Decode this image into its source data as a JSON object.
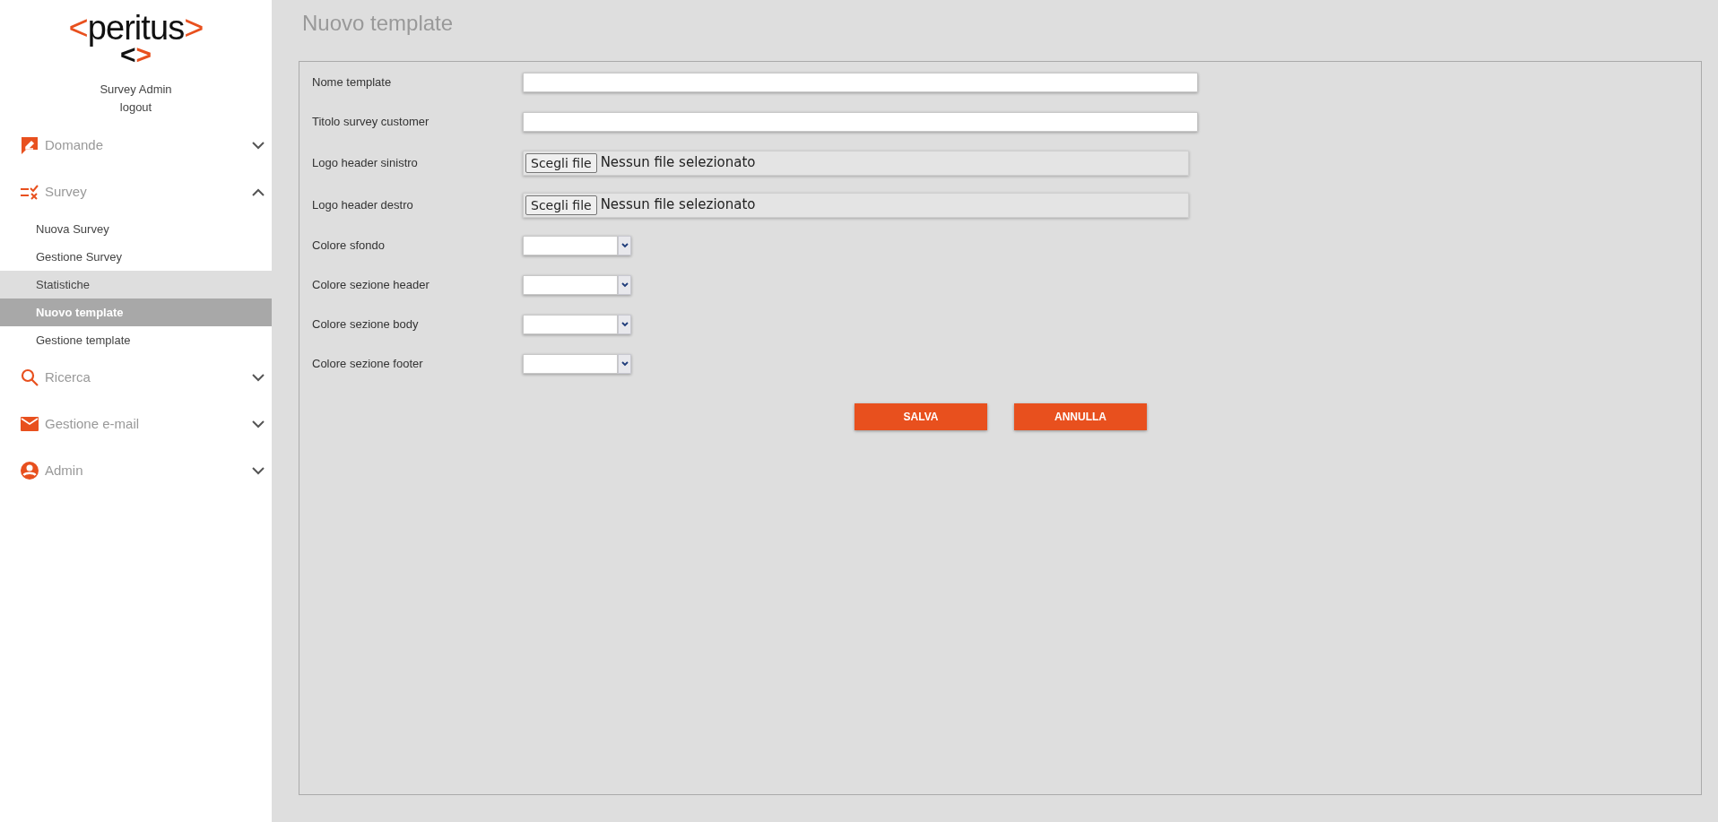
{
  "sidebar": {
    "logo": {
      "left_bracket": "<",
      "word": "peritus",
      "right_bracket": ">",
      "mark_left": "<",
      "mark_right": ">"
    },
    "user": "Survey Admin",
    "logout": "logout",
    "menu": [
      {
        "label": "Domande",
        "expanded": false
      },
      {
        "label": "Survey",
        "expanded": true,
        "children": [
          {
            "label": "Nuova Survey",
            "selected": false
          },
          {
            "label": "Gestione Survey",
            "selected": false
          },
          {
            "label": "Statistiche",
            "selected": false,
            "highlighted": true
          },
          {
            "label": "Nuovo template",
            "selected": true
          },
          {
            "label": "Gestione template",
            "selected": false
          }
        ]
      },
      {
        "label": "Ricerca",
        "expanded": false
      },
      {
        "label": "Gestione e-mail",
        "expanded": false
      },
      {
        "label": "Admin",
        "expanded": false
      }
    ]
  },
  "page_title": "Nuovo template",
  "form": {
    "fields": [
      {
        "kind": "text",
        "label": "Nome template"
      },
      {
        "kind": "text",
        "label": "Titolo survey customer"
      },
      {
        "kind": "file",
        "label": "Logo header sinistro",
        "button": "Scegli file",
        "status": "Nessun file selezionato"
      },
      {
        "kind": "file",
        "label": "Logo header destro",
        "button": "Scegli file",
        "status": "Nessun file selezionato"
      },
      {
        "kind": "color",
        "label": "Colore sfondo"
      },
      {
        "kind": "color",
        "label": "Colore sezione header"
      },
      {
        "kind": "color",
        "label": "Colore sezione body"
      },
      {
        "kind": "color",
        "label": "Colore sezione footer"
      }
    ],
    "buttons": [
      "SALVA",
      "ANNULLA"
    ]
  }
}
